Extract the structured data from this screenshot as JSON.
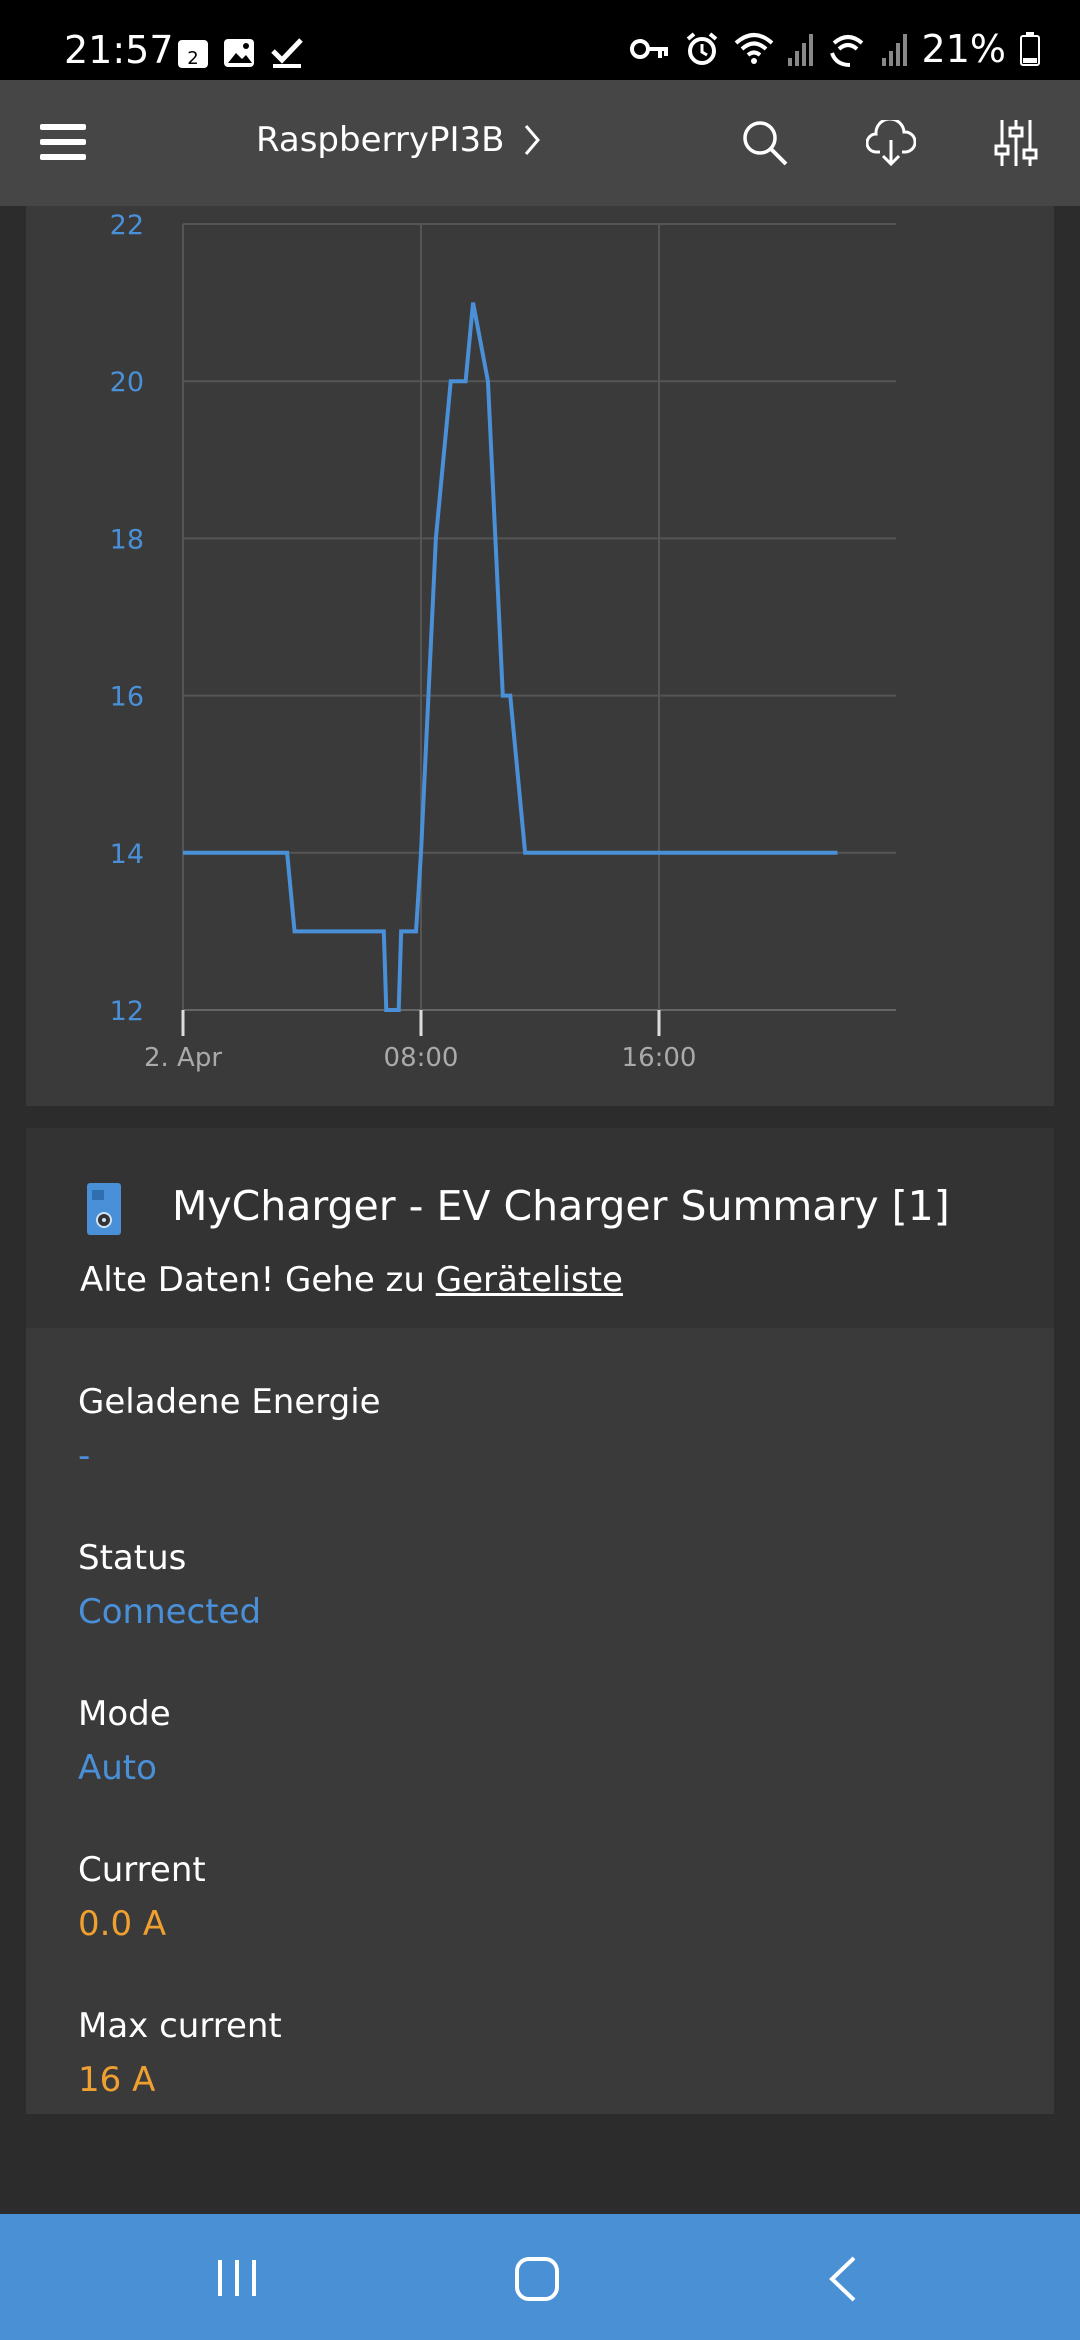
{
  "status_bar": {
    "time": "21:57",
    "calendar_day": "2",
    "battery_percent": "21%",
    "notification_icons": [
      "calendar-icon",
      "gallery-icon",
      "check-icon"
    ],
    "system_icons": [
      "vpn-key-icon",
      "alarm-icon",
      "wifi-icon",
      "signal-icon",
      "wifi-calling-icon",
      "signal-icon",
      "battery-icon"
    ]
  },
  "app_bar": {
    "title": "RaspberryPI3B",
    "icons": [
      "menu-icon",
      "chevron-right-icon",
      "search-icon",
      "cloud-download-icon",
      "settings-sliders-icon"
    ]
  },
  "chart_data": {
    "type": "line",
    "title": "",
    "xlabel": "",
    "ylabel": "",
    "ylim": [
      12,
      22
    ],
    "yticks": [
      "12",
      "14",
      "16",
      "18",
      "20",
      "22"
    ],
    "xticks": [
      "2. Apr",
      "08:00",
      "16:00"
    ],
    "grid": true,
    "color": "#4a90d9",
    "series": [
      {
        "x": [
          "00:00",
          "03:30",
          "03:45",
          "06:45",
          "06:50",
          "07:15",
          "07:20",
          "07:50",
          "08:00",
          "08:15",
          "08:30",
          "08:45",
          "09:00",
          "09:30",
          "09:45",
          "10:15",
          "10:30",
          "10:45",
          "11:00",
          "11:15",
          "11:30",
          "11:45",
          "12:00",
          "22:00"
        ],
        "values": [
          14,
          14,
          13,
          13,
          12,
          12,
          13,
          13,
          14,
          16,
          18,
          19,
          20,
          20,
          21,
          20,
          18,
          16,
          16,
          15,
          14,
          14,
          14,
          14
        ]
      }
    ]
  },
  "summary": {
    "icon": "device-icon",
    "title": "MyCharger - EV Charger Summary [1]",
    "warning_text": "Alte Daten! Gehe zu ",
    "warning_link": "Geräteliste",
    "fields": [
      {
        "label": "Geladene Energie",
        "value": "-",
        "color": "#4a90d9"
      },
      {
        "label": "Status",
        "value": "Connected",
        "color": "#4a90d9"
      },
      {
        "label": "Mode",
        "value": "Auto",
        "color": "#4a90d9"
      },
      {
        "label": "Current",
        "value": "0.0 A",
        "color": "#f0a030"
      },
      {
        "label": "Max current",
        "value": "16 A",
        "color": "#f0a030"
      }
    ]
  },
  "nav_bar": {
    "icons": [
      "recent-apps-icon",
      "home-icon",
      "back-icon"
    ],
    "color": "#4a90d4"
  }
}
